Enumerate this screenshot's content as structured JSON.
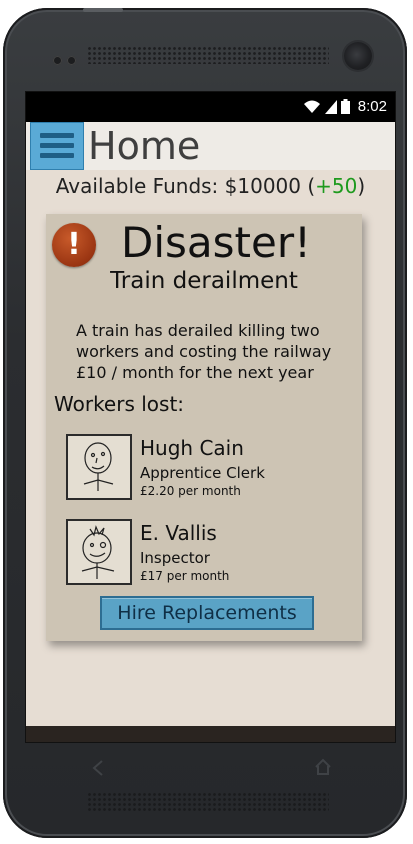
{
  "status_bar": {
    "time": "8:02"
  },
  "action_bar": {
    "title": "Home"
  },
  "funds": {
    "label": "Available Funds: $10000 (",
    "delta": "+50",
    "close": ")"
  },
  "alert": {
    "icon_glyph": "!",
    "title": "Disaster!",
    "subtitle": "Train derailment",
    "body": "A train has derailed killing two workers and costing the railway £10 / month for the next year"
  },
  "workers": {
    "heading": "Workers lost:",
    "items": [
      {
        "name": "Hugh Cain",
        "role": "Apprentice Clerk",
        "pay": "£2.20 per month"
      },
      {
        "name": "E. Vallis",
        "role": "Inspector",
        "pay": "£17 per month"
      }
    ]
  },
  "actions": {
    "hire_label": "Hire Replacements"
  },
  "colors": {
    "accent": "#5aa3c6",
    "positive": "#1e9a1e",
    "card": "#cdc4b4",
    "alert": "#9a3512"
  }
}
